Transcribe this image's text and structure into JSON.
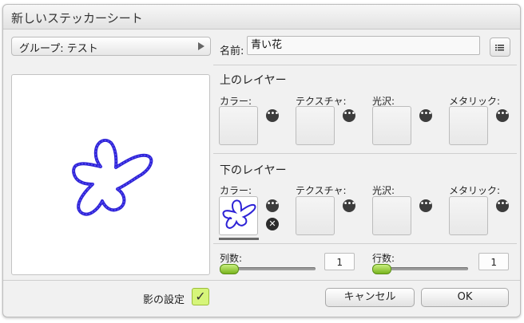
{
  "window": {
    "title": "新しいステッカーシート"
  },
  "group": {
    "label": "グループ: テスト",
    "arrow_icon": "triangle-right-icon"
  },
  "name": {
    "label": "名前:",
    "value": "青い花",
    "menu_icon": "list-menu-icon"
  },
  "upper_layer": {
    "title": "上のレイヤー",
    "color_label": "カラー:",
    "texture_label": "テクスチャ:",
    "gloss_label": "光沢:",
    "metallic_label": "メタリック:"
  },
  "lower_layer": {
    "title": "下のレイヤー",
    "color_label": "カラー:",
    "texture_label": "テクスチャ:",
    "gloss_label": "光沢:",
    "metallic_label": "メタリック:"
  },
  "columns": {
    "label": "列数:",
    "value": "1",
    "slider_fraction": 0
  },
  "rows": {
    "label": "行数:",
    "value": "1",
    "slider_fraction": 0
  },
  "shadow": {
    "label": "影の設定",
    "checked": true
  },
  "buttons": {
    "cancel": "キャンセル",
    "ok": "OK"
  },
  "colors": {
    "accent_green": "#9fd13a",
    "sticker_blue": "#2d22d6"
  }
}
